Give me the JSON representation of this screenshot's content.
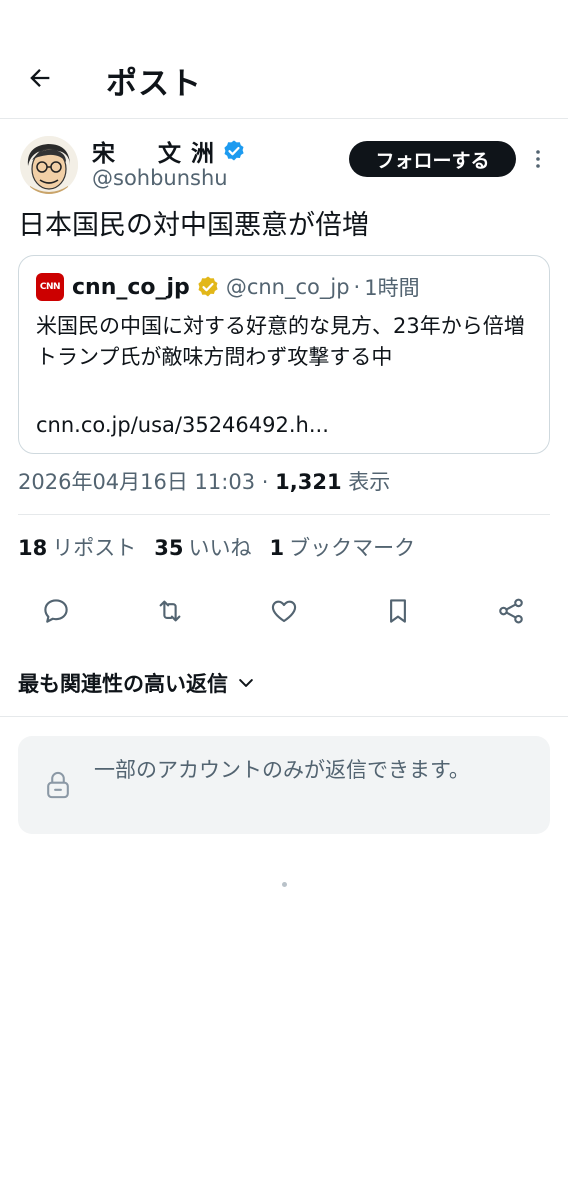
{
  "header": {
    "title": "ポスト",
    "back_icon": "arrow-left-icon"
  },
  "author": {
    "display_name": "宋　文洲",
    "handle": "@sohbunshu",
    "verified": true,
    "follow_label": "フォローする"
  },
  "post": {
    "text": "日本国民の対中国悪意が倍増"
  },
  "quoted": {
    "name": "cnn_co_jp",
    "logo_text": "CNN",
    "handle": "@cnn_co_jp",
    "separator": "·",
    "time": "1時間",
    "body": "米国民の中国に対する好意的な見方、23年から倍増　トランプ氏が敵味方問わず攻撃する中",
    "link": "cnn.co.jp/usa/35246492.h..."
  },
  "meta": {
    "datetime": "2026年04月16日 11:03",
    "separator": "·",
    "views": "1,321",
    "views_label": "表示"
  },
  "stats": {
    "reposts_count": "18",
    "reposts_label": "リポスト",
    "likes_count": "35",
    "likes_label": "いいね",
    "bookmarks_count": "1",
    "bookmarks_label": "ブックマーク"
  },
  "actions": [
    "reply-icon",
    "repost-icon",
    "like-icon",
    "bookmark-icon",
    "share-icon"
  ],
  "replies": {
    "sort_label": "最も関連性の高い返信",
    "restricted_text": "一部のアカウントのみが返信できます。"
  },
  "colors": {
    "text": "#0f1419",
    "muted": "#536471",
    "verified_blue": "#1d9bf0",
    "verified_gold": "#e2b719",
    "cnn_red": "#cc0000"
  }
}
